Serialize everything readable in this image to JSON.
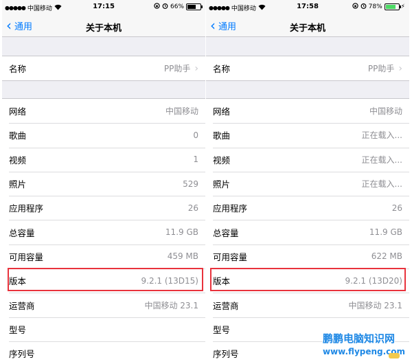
{
  "phones": [
    {
      "status": {
        "carrier": "中国移动",
        "time": "17:15",
        "battery_percent": "66%",
        "battery_level": 0.66,
        "battery_color": "#000000",
        "charging": false
      },
      "nav": {
        "back_label": "通用",
        "title": "关于本机"
      },
      "name_row": {
        "label": "名称",
        "value": "PP助手"
      },
      "rows": [
        {
          "label": "网络",
          "value": "中国移动"
        },
        {
          "label": "歌曲",
          "value": "0"
        },
        {
          "label": "视频",
          "value": "1"
        },
        {
          "label": "照片",
          "value": "529"
        },
        {
          "label": "应用程序",
          "value": "26"
        },
        {
          "label": "总容量",
          "value": "11.9 GB"
        },
        {
          "label": "可用容量",
          "value": "459 MB"
        },
        {
          "label": "版本",
          "value": "9.2.1 (13D15)"
        },
        {
          "label": "运营商",
          "value": "中国移动 23.1"
        },
        {
          "label": "型号",
          "value": ""
        },
        {
          "label": "序列号",
          "value": ""
        }
      ]
    },
    {
      "status": {
        "carrier": "中国移动",
        "time": "17:58",
        "battery_percent": "78%",
        "battery_level": 0.78,
        "battery_color": "#4cd964",
        "charging": true
      },
      "nav": {
        "back_label": "通用",
        "title": "关于本机"
      },
      "name_row": {
        "label": "名称",
        "value": "PP助手"
      },
      "rows": [
        {
          "label": "网络",
          "value": "中国移动"
        },
        {
          "label": "歌曲",
          "value": "正在载入..."
        },
        {
          "label": "视频",
          "value": "正在载入..."
        },
        {
          "label": "照片",
          "value": "正在载入..."
        },
        {
          "label": "应用程序",
          "value": "26"
        },
        {
          "label": "总容量",
          "value": "11.9 GB"
        },
        {
          "label": "可用容量",
          "value": "622 MB"
        },
        {
          "label": "版本",
          "value": "9.2.1 (13D20)"
        },
        {
          "label": "运营商",
          "value": "中国移动 23.1"
        },
        {
          "label": "型号",
          "value": ""
        },
        {
          "label": "序列号",
          "value": ""
        }
      ]
    }
  ],
  "watermark": {
    "title": "鹏鹏电脑知识网",
    "url": "www.flypeng.com"
  },
  "icons": {
    "back": "chevron-left-icon",
    "disclosure": "chevron-right-icon",
    "wifi": "wifi-icon",
    "alarm": "alarm-icon",
    "lock": "rotation-lock-icon",
    "battery": "battery-icon",
    "charging": "bolt-icon"
  },
  "colors": {
    "accent": "#007aff",
    "highlight": "#e8323c",
    "secondary_text": "#8e8e93",
    "background": "#efeff4",
    "watermark": "#1e88e5"
  }
}
